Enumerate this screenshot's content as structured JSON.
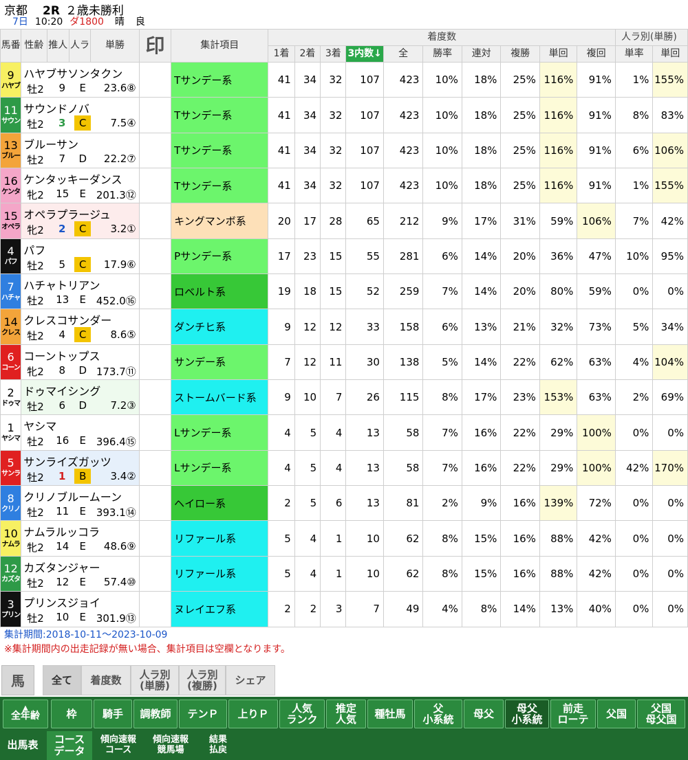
{
  "header": {
    "venue": "京都",
    "race_no": "2R",
    "race_name": "２歳未勝利",
    "day": "7日",
    "time": "10:20",
    "course": "ダ1800",
    "weather": "晴",
    "going": "良"
  },
  "columns": {
    "umaban": "馬番",
    "seirei": "性齢",
    "suitei": "推人",
    "ninki_rank": "人ラ",
    "tansho": "単勝",
    "mark": "印",
    "item": "集計項目",
    "group_chaku": "着度数",
    "group_ninki": "人ラ別(単勝)",
    "c1": "1着",
    "c2": "2着",
    "c3": "3着",
    "top3": "3内数↓",
    "all": "全",
    "win_rate": "勝率",
    "rentai": "連対",
    "fukusho": "複勝",
    "tankai": "単回",
    "fukukai": "複回",
    "ninki_win_rate": "単率",
    "ninki_tankai": "単回"
  },
  "rows": [
    {
      "num": "9",
      "abbr": "ハヤブ",
      "num_bg": "#f7f062",
      "num_fg": "#000",
      "name": "ハヤブサソンタクン",
      "sex": "牡2",
      "pop": "9",
      "pop_color": "#000",
      "rank": "E",
      "rank_hl": false,
      "odds": "23.6⑧",
      "row_bg": "#ffffff",
      "item": "Tサンデー系",
      "item_bg": "#6cf56c",
      "c1": "41",
      "c2": "34",
      "c3": "32",
      "top3": "107",
      "all": "423",
      "win": "10%",
      "rentai": "18%",
      "fuku": "25%",
      "tankai": "116%",
      "tankai_y": true,
      "fukukai": "91%",
      "fukukai_y": false,
      "nwin": "1%",
      "ntankai": "155%",
      "ntankai_y": true
    },
    {
      "num": "11",
      "abbr": "サウン",
      "num_bg": "#2e9a47",
      "num_fg": "#fff",
      "name": "サウンドノバ",
      "sex": "牡2",
      "pop": "3",
      "pop_color": "#2e9a47",
      "rank": "C",
      "rank_hl": true,
      "odds": "7.5④",
      "row_bg": "#ffffff",
      "item": "Tサンデー系",
      "item_bg": "#6cf56c",
      "c1": "41",
      "c2": "34",
      "c3": "32",
      "top3": "107",
      "all": "423",
      "win": "10%",
      "rentai": "18%",
      "fuku": "25%",
      "tankai": "116%",
      "tankai_y": true,
      "fukukai": "91%",
      "fukukai_y": false,
      "nwin": "8%",
      "ntankai": "83%",
      "ntankai_y": false
    },
    {
      "num": "13",
      "abbr": "ブルー",
      "num_bg": "#f3a43a",
      "num_fg": "#000",
      "name": "ブルーサン",
      "sex": "牡2",
      "pop": "7",
      "pop_color": "#000",
      "rank": "D",
      "rank_hl": false,
      "odds": "22.2⑦",
      "row_bg": "#ffffff",
      "item": "Tサンデー系",
      "item_bg": "#6cf56c",
      "c1": "41",
      "c2": "34",
      "c3": "32",
      "top3": "107",
      "all": "423",
      "win": "10%",
      "rentai": "18%",
      "fuku": "25%",
      "tankai": "116%",
      "tankai_y": true,
      "fukukai": "91%",
      "fukukai_y": false,
      "nwin": "6%",
      "ntankai": "106%",
      "ntankai_y": true
    },
    {
      "num": "16",
      "abbr": "ケンタ",
      "num_bg": "#f4a6c8",
      "num_fg": "#000",
      "name": "ケンタッキーダンス",
      "sex": "牝2",
      "pop": "15",
      "pop_color": "#000",
      "rank": "E",
      "rank_hl": false,
      "odds": "201.3⑫",
      "row_bg": "#ffffff",
      "item": "Tサンデー系",
      "item_bg": "#6cf56c",
      "c1": "41",
      "c2": "34",
      "c3": "32",
      "top3": "107",
      "all": "423",
      "win": "10%",
      "rentai": "18%",
      "fuku": "25%",
      "tankai": "116%",
      "tankai_y": true,
      "fukukai": "91%",
      "fukukai_y": false,
      "nwin": "1%",
      "ntankai": "155%",
      "ntankai_y": true
    },
    {
      "num": "15",
      "abbr": "オペラ",
      "num_bg": "#f4a6c8",
      "num_fg": "#000",
      "name": "オペラプラージュ",
      "sex": "牝2",
      "pop": "2",
      "pop_color": "#1a55c8",
      "rank": "C",
      "rank_hl": true,
      "odds": "3.2①",
      "row_bg": "#fdecec",
      "item": "キングマンボ系",
      "item_bg": "#fde0b8",
      "c1": "20",
      "c2": "17",
      "c3": "28",
      "top3": "65",
      "all": "212",
      "win": "9%",
      "rentai": "17%",
      "fuku": "31%",
      "tankai": "59%",
      "tankai_y": false,
      "fukukai": "106%",
      "fukukai_y": true,
      "nwin": "7%",
      "ntankai": "42%",
      "ntankai_y": false
    },
    {
      "num": "4",
      "abbr": "パフ",
      "num_bg": "#111111",
      "num_fg": "#fff",
      "name": "パフ",
      "sex": "牡2",
      "pop": "5",
      "pop_color": "#000",
      "rank": "C",
      "rank_hl": true,
      "odds": "17.9⑥",
      "row_bg": "#ffffff",
      "item": "Pサンデー系",
      "item_bg": "#6cf56c",
      "c1": "17",
      "c2": "23",
      "c3": "15",
      "top3": "55",
      "all": "281",
      "win": "6%",
      "rentai": "14%",
      "fuku": "20%",
      "tankai": "36%",
      "tankai_y": false,
      "fukukai": "47%",
      "fukukai_y": false,
      "nwin": "10%",
      "ntankai": "95%",
      "ntankai_y": false
    },
    {
      "num": "7",
      "abbr": "ハチャ",
      "num_bg": "#2f7fe0",
      "num_fg": "#fff",
      "name": "ハチャトリアン",
      "sex": "牡2",
      "pop": "13",
      "pop_color": "#000",
      "rank": "E",
      "rank_hl": false,
      "odds": "452.0⑯",
      "row_bg": "#ffffff",
      "item": "ロベルト系",
      "item_bg": "#37c837",
      "c1": "19",
      "c2": "18",
      "c3": "15",
      "top3": "52",
      "all": "259",
      "win": "7%",
      "rentai": "14%",
      "fuku": "20%",
      "tankai": "80%",
      "tankai_y": false,
      "fukukai": "59%",
      "fukukai_y": false,
      "nwin": "0%",
      "ntankai": "0%",
      "ntankai_y": false
    },
    {
      "num": "14",
      "abbr": "クレス",
      "num_bg": "#f3a43a",
      "num_fg": "#000",
      "name": "クレスコサンダー",
      "sex": "牡2",
      "pop": "4",
      "pop_color": "#000",
      "rank": "C",
      "rank_hl": true,
      "odds": "8.6⑤",
      "row_bg": "#ffffff",
      "item": "ダンチヒ系",
      "item_bg": "#1ff0f0",
      "c1": "9",
      "c2": "12",
      "c3": "12",
      "top3": "33",
      "all": "158",
      "win": "6%",
      "rentai": "13%",
      "fuku": "21%",
      "tankai": "32%",
      "tankai_y": false,
      "fukukai": "73%",
      "fukukai_y": false,
      "nwin": "5%",
      "ntankai": "34%",
      "ntankai_y": false
    },
    {
      "num": "6",
      "abbr": "コーン",
      "num_bg": "#e02020",
      "num_fg": "#fff",
      "name": "コーントップス",
      "sex": "牝2",
      "pop": "8",
      "pop_color": "#000",
      "rank": "D",
      "rank_hl": false,
      "odds": "173.7⑪",
      "row_bg": "#ffffff",
      "item": "サンデー系",
      "item_bg": "#6cf56c",
      "c1": "7",
      "c2": "12",
      "c3": "11",
      "top3": "30",
      "all": "138",
      "win": "5%",
      "rentai": "14%",
      "fuku": "22%",
      "tankai": "62%",
      "tankai_y": false,
      "fukukai": "63%",
      "fukukai_y": false,
      "nwin": "4%",
      "ntankai": "104%",
      "ntankai_y": true
    },
    {
      "num": "2",
      "abbr": "ドゥマ",
      "num_bg": "#ffffff",
      "num_fg": "#000",
      "name": "ドゥマイシング",
      "sex": "牡2",
      "pop": "6",
      "pop_color": "#000",
      "rank": "D",
      "rank_hl": false,
      "odds": "7.2③",
      "row_bg": "#eefaee",
      "item": "ストームバード系",
      "item_bg": "#1ff0f0",
      "c1": "9",
      "c2": "10",
      "c3": "7",
      "top3": "26",
      "all": "115",
      "win": "8%",
      "rentai": "17%",
      "fuku": "23%",
      "tankai": "153%",
      "tankai_y": true,
      "fukukai": "63%",
      "fukukai_y": false,
      "nwin": "2%",
      "ntankai": "69%",
      "ntankai_y": false
    },
    {
      "num": "1",
      "abbr": "ヤシマ",
      "num_bg": "#ffffff",
      "num_fg": "#000",
      "name": "ヤシマ",
      "sex": "牡2",
      "pop": "16",
      "pop_color": "#000",
      "rank": "E",
      "rank_hl": false,
      "odds": "396.4⑮",
      "row_bg": "#ffffff",
      "item": "Lサンデー系",
      "item_bg": "#6cf56c",
      "c1": "4",
      "c2": "5",
      "c3": "4",
      "top3": "13",
      "all": "58",
      "win": "7%",
      "rentai": "16%",
      "fuku": "22%",
      "tankai": "29%",
      "tankai_y": false,
      "fukukai": "100%",
      "fukukai_y": true,
      "nwin": "0%",
      "ntankai": "0%",
      "ntankai_y": false
    },
    {
      "num": "5",
      "abbr": "サンラ",
      "num_bg": "#e02020",
      "num_fg": "#fff",
      "name": "サンライズガッツ",
      "sex": "牡2",
      "pop": "1",
      "pop_color": "#d42020",
      "rank": "B",
      "rank_hl": true,
      "odds": "3.4②",
      "row_bg": "#e6f0fb",
      "item": "Lサンデー系",
      "item_bg": "#6cf56c",
      "c1": "4",
      "c2": "5",
      "c3": "4",
      "top3": "13",
      "all": "58",
      "win": "7%",
      "rentai": "16%",
      "fuku": "22%",
      "tankai": "29%",
      "tankai_y": false,
      "fukukai": "100%",
      "fukukai_y": true,
      "nwin": "42%",
      "ntankai": "170%",
      "ntankai_y": true
    },
    {
      "num": "8",
      "abbr": "クリノ",
      "num_bg": "#2f7fe0",
      "num_fg": "#fff",
      "name": "クリノブルームーン",
      "sex": "牡2",
      "pop": "11",
      "pop_color": "#000",
      "rank": "E",
      "rank_hl": false,
      "odds": "393.1⑭",
      "row_bg": "#ffffff",
      "item": "ヘイロー系",
      "item_bg": "#37c837",
      "c1": "2",
      "c2": "5",
      "c3": "6",
      "top3": "13",
      "all": "81",
      "win": "2%",
      "rentai": "9%",
      "fuku": "16%",
      "tankai": "139%",
      "tankai_y": true,
      "fukukai": "72%",
      "fukukai_y": false,
      "nwin": "0%",
      "ntankai": "0%",
      "ntankai_y": false
    },
    {
      "num": "10",
      "abbr": "ナムラ",
      "num_bg": "#f7f062",
      "num_fg": "#000",
      "name": "ナムラルッコラ",
      "sex": "牝2",
      "pop": "14",
      "pop_color": "#000",
      "rank": "E",
      "rank_hl": false,
      "odds": "48.6⑨",
      "row_bg": "#ffffff",
      "item": "リファール系",
      "item_bg": "#1ff0f0",
      "c1": "5",
      "c2": "4",
      "c3": "1",
      "top3": "10",
      "all": "62",
      "win": "8%",
      "rentai": "15%",
      "fuku": "16%",
      "tankai": "88%",
      "tankai_y": false,
      "fukukai": "42%",
      "fukukai_y": false,
      "nwin": "0%",
      "ntankai": "0%",
      "ntankai_y": false
    },
    {
      "num": "12",
      "abbr": "カズタ",
      "num_bg": "#2e9a47",
      "num_fg": "#fff",
      "name": "カズタンジャー",
      "sex": "牡2",
      "pop": "12",
      "pop_color": "#000",
      "rank": "E",
      "rank_hl": false,
      "odds": "57.4⑩",
      "row_bg": "#ffffff",
      "item": "リファール系",
      "item_bg": "#1ff0f0",
      "c1": "5",
      "c2": "4",
      "c3": "1",
      "top3": "10",
      "all": "62",
      "win": "8%",
      "rentai": "15%",
      "fuku": "16%",
      "tankai": "88%",
      "tankai_y": false,
      "fukukai": "42%",
      "fukukai_y": false,
      "nwin": "0%",
      "ntankai": "0%",
      "ntankai_y": false
    },
    {
      "num": "3",
      "abbr": "プリン",
      "num_bg": "#111111",
      "num_fg": "#fff",
      "name": "プリンスジョイ",
      "sex": "牡2",
      "pop": "10",
      "pop_color": "#000",
      "rank": "E",
      "rank_hl": false,
      "odds": "301.9⑬",
      "row_bg": "#ffffff",
      "item": "ヌレイエフ系",
      "item_bg": "#1ff0f0",
      "c1": "2",
      "c2": "2",
      "c3": "3",
      "top3": "7",
      "all": "49",
      "win": "4%",
      "rentai": "8%",
      "fuku": "14%",
      "tankai": "13%",
      "tankai_y": false,
      "fukukai": "40%",
      "fukukai_y": false,
      "nwin": "0%",
      "ntankai": "0%",
      "ntankai_y": false
    }
  ],
  "notes": {
    "period": "集計期間:2018-10-11～2023-10-09",
    "warning": "※集計期間内の出走記録が無い場合、集計項目は空欄となります。"
  },
  "subtabs": {
    "horse": "馬",
    "all": "全て",
    "chaku": "着度数",
    "ninki_tan_1": "人ラ別",
    "ninki_tan_2": "(単勝)",
    "ninki_fuku_1": "人ラ別",
    "ninki_fuku_2": "(複勝)",
    "share": "シェア"
  },
  "nav1": {
    "all_age": "全年齢",
    "waku": "枠",
    "jockey": "騎手",
    "trainer": "調教師",
    "tenp": "テンＰ",
    "agarip": "上りＰ",
    "ninki_1": "人気",
    "ninki_2": "ランク",
    "suitei_1": "推定",
    "suitei_2": "人気",
    "sire": "種牡馬",
    "chichi_1": "父",
    "chichi_2": "小系統",
    "hahachichi": "母父",
    "hahachichi_s_1": "母父",
    "hahachichi_s_2": "小系統",
    "zenso_1": "前走",
    "zenso_2": "ローテ",
    "chichikoku": "父国",
    "chichi_hahachichi_1": "父国",
    "chichi_hahachichi_2": "母父国"
  },
  "nav2": {
    "shutuba": "出馬表",
    "course_1": "コース",
    "course_2": "データ",
    "keiko_c_1": "傾向速報",
    "keiko_c_2": "コース",
    "keiko_j_1": "傾向速報",
    "keiko_j_2": "競馬場",
    "result_1": "結果",
    "result_2": "払戻"
  }
}
